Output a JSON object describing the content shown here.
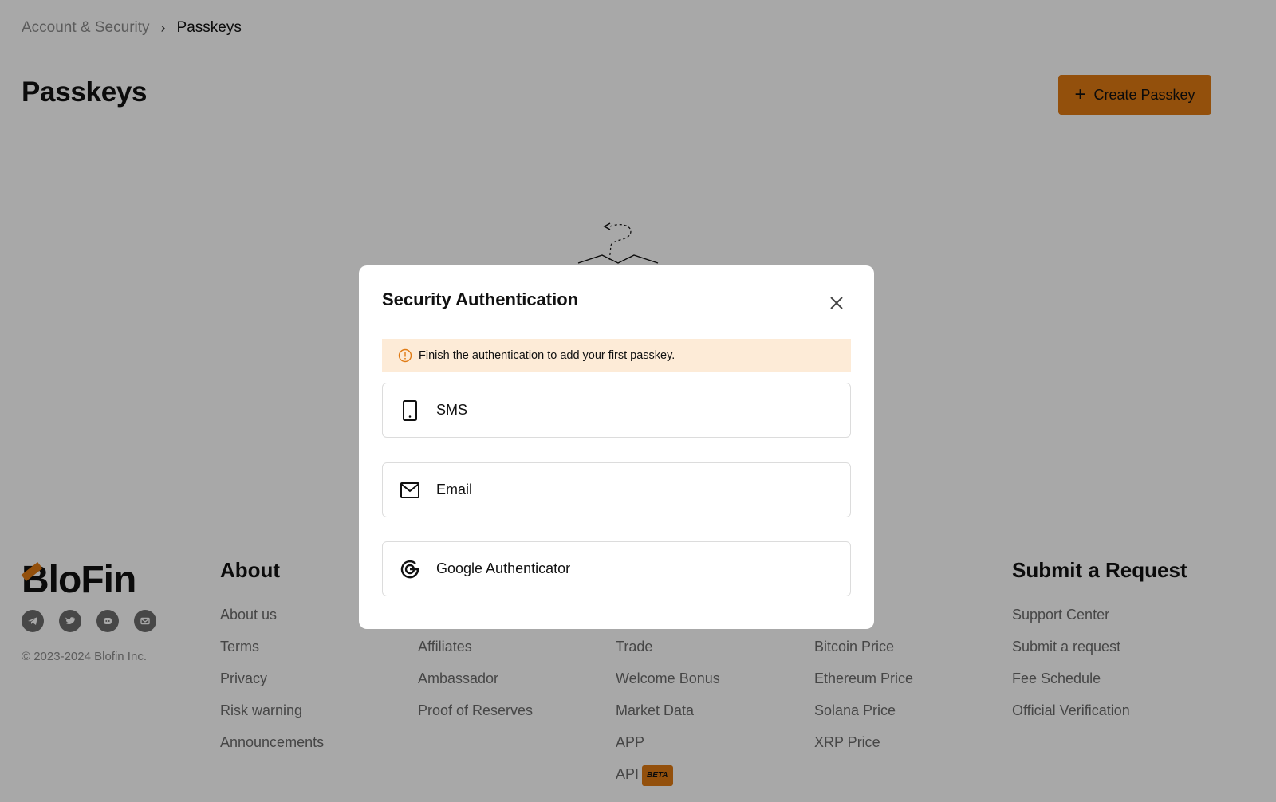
{
  "breadcrumb": {
    "parent": "Account & Security",
    "separator": "›",
    "current": "Passkeys"
  },
  "page": {
    "title": "Passkeys",
    "create_button": "Create Passkey"
  },
  "footer": {
    "brand": "BloFin",
    "socials": [
      "telegram-icon",
      "twitter-icon",
      "discord-icon",
      "mail-icon"
    ],
    "copyright": "© 2023-2024 Blofin Inc.",
    "about": {
      "title": "About",
      "links": [
        "About us",
        "Terms",
        "Privacy",
        "Risk warning",
        "Announcements"
      ]
    },
    "col2": {
      "links": [
        "Affiliates",
        "Ambassador",
        "Proof of Reserves"
      ]
    },
    "col3": {
      "links": [
        "Trade",
        "Welcome Bonus",
        "Market Data",
        "APP",
        "API"
      ],
      "api_badge": "BETA"
    },
    "col4": {
      "links": [
        "ice",
        "Bitcoin Price",
        "Ethereum Price",
        "Solana Price",
        "XRP Price"
      ]
    },
    "request": {
      "title": "Submit a Request",
      "links": [
        "Support Center",
        "Submit a request",
        "Fee Schedule",
        "Official Verification"
      ]
    }
  },
  "modal": {
    "title": "Security Authentication",
    "notice": "Finish the authentication to add your first passkey.",
    "methods": [
      {
        "label": "SMS",
        "icon": "phone-icon"
      },
      {
        "label": "Email",
        "icon": "mail-icon"
      },
      {
        "label": "Google Authenticator",
        "icon": "google-icon"
      }
    ]
  },
  "colors": {
    "accent": "#e07a13",
    "notice_bg": "#fdebd7"
  }
}
